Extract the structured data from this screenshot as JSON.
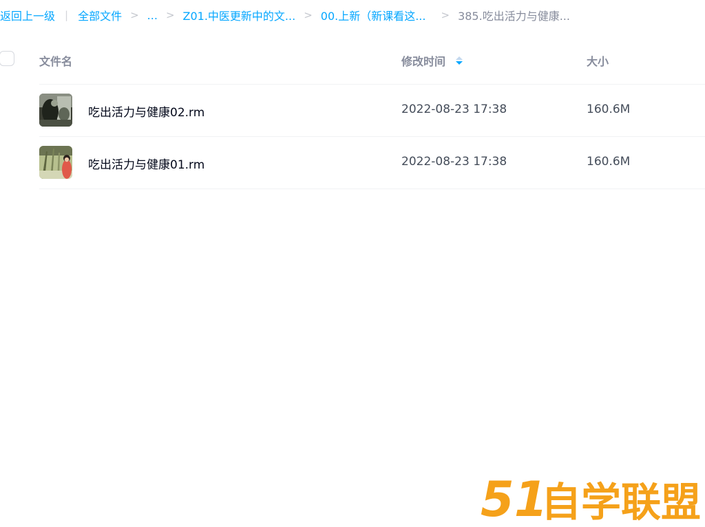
{
  "breadcrumb": {
    "back": "返回上一级",
    "all_files": "全部文件",
    "ellipsis": "...",
    "folder1": "Z01.中医更新中的文...",
    "folder2": "00.上新（新课看这...",
    "current": "385.吃出活力与健康..."
  },
  "header": {
    "name": "文件名",
    "modified": "修改时间",
    "size": "大小"
  },
  "files": [
    {
      "name": "吃出活力与健康02.rm",
      "modified": "2022-08-23 17:38",
      "size": "160.6M",
      "thumb_icon": "video-thumbnail-dark"
    },
    {
      "name": "吃出活力与健康01.rm",
      "modified": "2022-08-23 17:38",
      "size": "160.6M",
      "thumb_icon": "video-thumbnail-forest"
    }
  ],
  "watermark": {
    "text": "51自学联盟",
    "color": "#f5a11a"
  },
  "colors": {
    "accent": "#06a7ff",
    "text_primary": "#03081a",
    "text_secondary": "#454d5a",
    "text_muted": "#878c9c"
  }
}
